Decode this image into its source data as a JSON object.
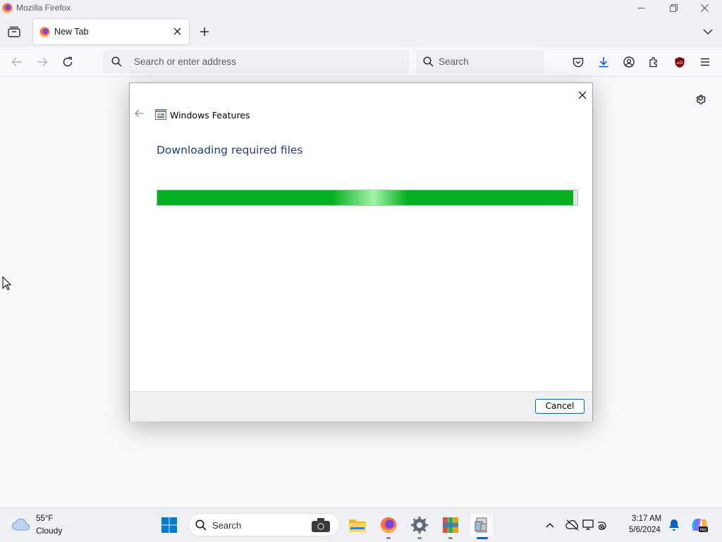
{
  "window": {
    "title": "Mozilla Firefox"
  },
  "tabs": [
    {
      "label": "New Tab",
      "active": true
    }
  ],
  "urlbar": {
    "placeholder": "Search or enter address"
  },
  "searchbar": {
    "placeholder": "Search"
  },
  "dialog": {
    "title": "Windows Features",
    "heading": "Downloading required files",
    "progress": 0.99,
    "cancel_label": "Cancel"
  },
  "taskbar": {
    "weather": {
      "temp": "55°F",
      "condition": "Cloudy"
    },
    "search_label": "Search",
    "clock": {
      "time": "3:17 AM",
      "date": "5/6/2024"
    }
  },
  "colors": {
    "progress_green": "#06b025",
    "heading_blue": "#1e3c8c",
    "accent_blue": "#0067c0"
  },
  "icons": [
    "firefox-icon",
    "minimize-icon",
    "restore-icon",
    "close-icon",
    "tab-overview-icon",
    "add-tab-icon",
    "list-all-tabs-icon",
    "back-icon",
    "forward-icon",
    "reload-icon",
    "search-icon",
    "pocket-icon",
    "downloads-icon",
    "account-icon",
    "extensions-icon",
    "ublock-icon",
    "menu-icon",
    "gear-icon",
    "windows-features-icon",
    "weather-cloud-icon",
    "windows-start-icon",
    "file-explorer-icon",
    "settings-icon",
    "office-icon",
    "installer-icon",
    "chevron-up-icon",
    "network-icon",
    "notification-bell-icon",
    "copilot-icon"
  ]
}
